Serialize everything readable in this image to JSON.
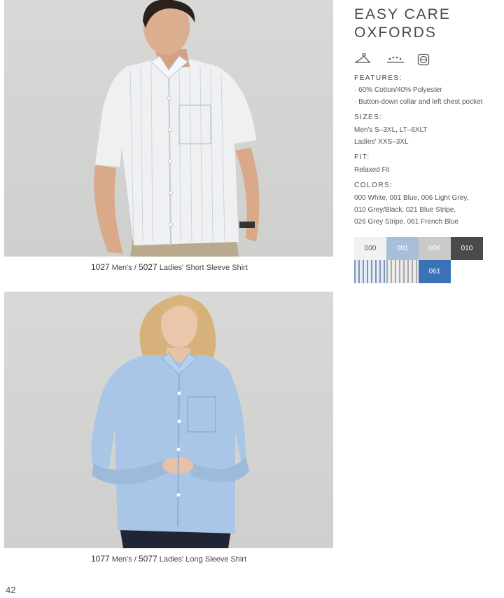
{
  "product": {
    "title_line1": "EASY CARE",
    "title_line2": "OXFORDS"
  },
  "care_icons": [
    "hanger-icon",
    "iron-icon",
    "wash-icon"
  ],
  "features": {
    "label": "FEATURES:",
    "items": [
      "· 60% Cotton/40% Polyester",
      "· Button-down collar and left chest pocket"
    ]
  },
  "sizes": {
    "label": "SIZES:",
    "mens": "Men's S–3XL, LT–6XLT",
    "ladies": "Ladies' XXS–3XL"
  },
  "fit": {
    "label": "FIT:",
    "value": "Relaxed Fit"
  },
  "colors": {
    "label": "COLORS:",
    "lines": [
      "000 White, 001 Blue, 006 Light Grey,",
      "010 Grey/Black, 021 Blue Stripe,",
      "026 Grey Stripe, 061 French Blue"
    ],
    "swatches": [
      {
        "code": "000",
        "hex": "#f1f1f1",
        "text": "#555555"
      },
      {
        "code": "001",
        "hex": "#a9bfd9",
        "text": "#ffffff"
      },
      {
        "code": "006",
        "hex": "#c9c9c9",
        "text": "#ffffff"
      },
      {
        "code": "010",
        "hex": "#4a4a4a",
        "text": "#ffffff"
      },
      {
        "code": "",
        "hex": "#c8d3e0",
        "text": "#ffffff"
      },
      {
        "code": "",
        "hex": "#dadada",
        "text": "#ffffff"
      },
      {
        "code": "061",
        "hex": "#3a72b8",
        "text": "#ffffff"
      }
    ]
  },
  "captions": {
    "top": {
      "code1": "1027",
      "mens": "Men's /",
      "code2": "5027",
      "desc": "Ladies' Short Sleeve Shirt"
    },
    "bottom": {
      "code1": "1077",
      "mens": "Men's /",
      "code2": "5077",
      "desc": "Ladies' Long Sleeve Shirt"
    }
  },
  "page_number": "42"
}
